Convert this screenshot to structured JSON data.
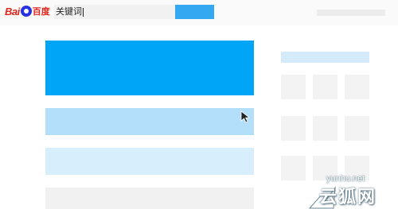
{
  "header": {
    "logo": {
      "latin_part1": "Bai",
      "latin_part2": "",
      "chinese": "百度",
      "paw_icon": "baidu-paw-icon"
    },
    "search": {
      "value": "关键词"
    }
  },
  "watermark": {
    "url": "yunhu.net",
    "brand": "云狐网"
  },
  "colors": {
    "primary_blue": "#00a5f7",
    "light_blue": "#b3dffa",
    "pale_blue": "#d7eefc",
    "search_button": "#35a8f2",
    "logo_red": "#e1261c",
    "logo_paw": "#2932e1"
  }
}
